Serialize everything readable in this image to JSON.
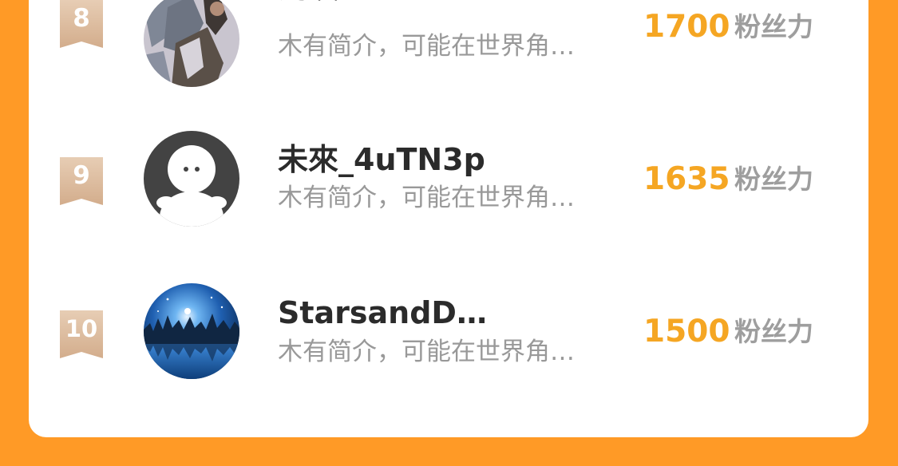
{
  "ranking": {
    "items": [
      {
        "rank": "8",
        "name": "鸿唉",
        "bio": "木有简介，可能在世界角…",
        "score": "1700",
        "unit": "粉丝力",
        "avatar_icon": "wolf-character-art"
      },
      {
        "rank": "9",
        "name": "未來_4uTN3p",
        "bio": "木有简介，可能在世界角…",
        "score": "1635",
        "unit": "粉丝力",
        "avatar_icon": "default-user-icon"
      },
      {
        "rank": "10",
        "name": "StarsandD…",
        "bio": "木有简介，可能在世界角…",
        "score": "1500",
        "unit": "粉丝力",
        "avatar_icon": "night-sky-lake-photo"
      }
    ]
  },
  "colors": {
    "background": "#FF9A26",
    "card": "#FFFFFF",
    "score": "#F5A623",
    "rank_badge": "#D9B89A",
    "name": "#2B2B2B",
    "bio": "#999999",
    "unit": "#9E9E9E"
  }
}
